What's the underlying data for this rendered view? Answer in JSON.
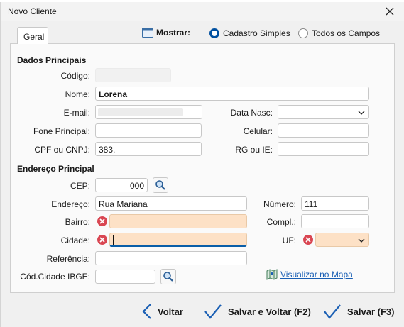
{
  "window": {
    "title": "Novo Cliente"
  },
  "tab": {
    "label": "Geral"
  },
  "mostrar": {
    "label": "Mostrar:",
    "options": [
      {
        "label": "Cadastro Simples",
        "selected": true
      },
      {
        "label": "Todos os Campos",
        "selected": false
      }
    ]
  },
  "principais": {
    "title": "Dados Principais",
    "codigo": {
      "label": "Código:",
      "value": ""
    },
    "nome": {
      "label": "Nome:",
      "value": "Lorena"
    },
    "email": {
      "label": "E-mail:",
      "value": ""
    },
    "data_nasc": {
      "label": "Data Nasc:",
      "value": ""
    },
    "fone": {
      "label": "Fone Principal:",
      "value": ""
    },
    "celular": {
      "label": "Celular:",
      "value": ""
    },
    "cpf": {
      "label": "CPF ou CNPJ:",
      "value": "383."
    },
    "rg": {
      "label": "RG ou IE:",
      "value": ""
    }
  },
  "endereco": {
    "title": "Endereço Principal",
    "cep": {
      "label": "CEP:",
      "value": "000"
    },
    "endereco": {
      "label": "Endereço:",
      "value": "Rua Mariana"
    },
    "numero": {
      "label": "Número:",
      "value": "111"
    },
    "bairro": {
      "label": "Bairro:",
      "value": ""
    },
    "compl": {
      "label": "Compl.:",
      "value": ""
    },
    "cidade": {
      "label": "Cidade:",
      "value": ""
    },
    "uf": {
      "label": "UF:",
      "value": ""
    },
    "referencia": {
      "label": "Referência:",
      "value": ""
    },
    "ibge": {
      "label": "Cód.Cidade IBGE:",
      "value": ""
    },
    "map_link": "Visualizar no Mapa"
  },
  "footer": {
    "voltar": "Voltar",
    "salvar_voltar": "Salvar e Voltar (F2)",
    "salvar": "Salvar (F3)"
  },
  "colors": {
    "accent": "#1a5fb4",
    "error": "#d94652",
    "error_field": "#fde1c6"
  }
}
